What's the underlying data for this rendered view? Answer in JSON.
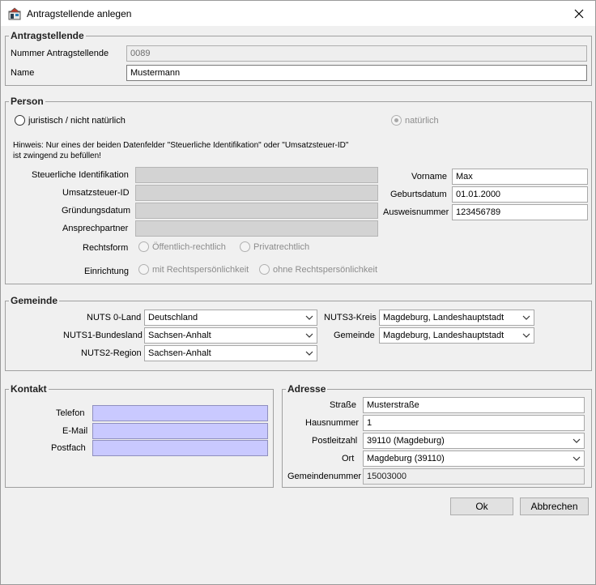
{
  "window": {
    "title": "Antragstellende anlegen"
  },
  "antragsteller": {
    "title": "Antragstellende",
    "nummer_label": "Nummer Antragstellende",
    "nummer_value": "0089",
    "name_label": "Name",
    "name_value": "Mustermann"
  },
  "person": {
    "title": "Person",
    "radio_juristisch": "juristisch / nicht natürlich",
    "radio_natuerlich": "natürlich",
    "hint_line1": "Hinweis: Nur eines der beiden Datenfelder \"Steuerliche Identifikation\" oder \"Umsatzsteuer-ID\"",
    "hint_line2": "ist zwingend zu befüllen!",
    "steuer_label": "Steuerliche Identifikation",
    "ust_label": "Umsatzsteuer-ID",
    "gruendung_label": "Gründungsdatum",
    "ansprech_label": "Ansprechpartner",
    "rechtsform_label": "Rechtsform",
    "rechtsform_opt1": "Öffentlich-rechtlich",
    "rechtsform_opt2": "Privatrechtlich",
    "einrichtung_label": "Einrichtung",
    "einrichtung_opt1": "mit Rechtspersönlichkeit",
    "einrichtung_opt2": "ohne Rechtspersönlichkeit",
    "vorname_label": "Vorname",
    "vorname_value": "Max",
    "geburt_label": "Geburtsdatum",
    "geburt_value": "01.01.2000",
    "ausweis_label": "Ausweisnummer",
    "ausweis_value": "123456789"
  },
  "gemeinde": {
    "title": "Gemeinde",
    "nuts0_label": "NUTS 0-Land",
    "nuts0_value": "Deutschland",
    "nuts1_label": "NUTS1-Bundesland",
    "nuts1_value": "Sachsen-Anhalt",
    "nuts2_label": "NUTS2-Region",
    "nuts2_value": "Sachsen-Anhalt",
    "nuts3_label": "NUTS3-Kreis",
    "nuts3_value": "Magdeburg, Landeshauptstadt",
    "gemeinde_label": "Gemeinde",
    "gemeinde_value": "Magdeburg, Landeshauptstadt"
  },
  "kontakt": {
    "title": "Kontakt",
    "telefon_label": "Telefon",
    "email_label": "E-Mail",
    "postfach_label": "Postfach"
  },
  "adresse": {
    "title": "Adresse",
    "strasse_label": "Straße",
    "strasse_value": "Musterstraße",
    "hausnr_label": "Hausnummer",
    "hausnr_value": "1",
    "plz_label": "Postleitzahl",
    "plz_value": "39110 (Magdeburg)",
    "ort_label": "Ort",
    "ort_value": "Magdeburg (39110)",
    "gemnr_label": "Gemeindenummer",
    "gemnr_value": "15003000"
  },
  "buttons": {
    "ok": "Ok",
    "cancel": "Abbrechen"
  },
  "colors": {
    "contact_field_bg": "#c9c9ff",
    "disabled_field_bg": "#d3d3d3"
  }
}
